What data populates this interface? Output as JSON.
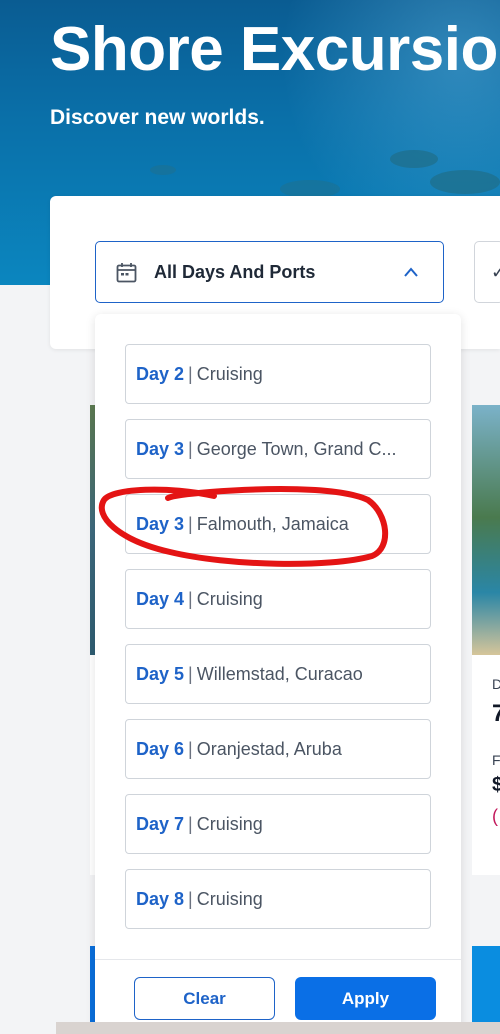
{
  "hero": {
    "title": "Shore Excursions",
    "subtitle": "Discover new worlds."
  },
  "filter": {
    "days_select_label": "All Days And Ports",
    "second_select_glyph": "✓"
  },
  "dropdown": {
    "separator": "|",
    "options": [
      {
        "day": "Day 2",
        "port": "Cruising"
      },
      {
        "day": "Day 3",
        "port": "George Town, Grand C..."
      },
      {
        "day": "Day 3",
        "port": "Falmouth, Jamaica"
      },
      {
        "day": "Day 4",
        "port": "Cruising"
      },
      {
        "day": "Day 5",
        "port": "Willemstad, Curacao"
      },
      {
        "day": "Day 6",
        "port": "Oranjestad, Aruba"
      },
      {
        "day": "Day 7",
        "port": "Cruising"
      },
      {
        "day": "Day 8",
        "port": "Cruising"
      }
    ],
    "clear_label": "Clear",
    "apply_label": "Apply"
  },
  "peek_card": {
    "label_letter": "D",
    "value_digit": "7",
    "price_label_letter": "F",
    "price_symbol": "$",
    "red_paren": "("
  },
  "colors": {
    "accent": "#1e63c8",
    "apply_button": "#0a6fe6",
    "annotation": "#e41414"
  },
  "icons": {
    "calendar": "calendar-icon",
    "chevron": "chevron-up-icon"
  }
}
